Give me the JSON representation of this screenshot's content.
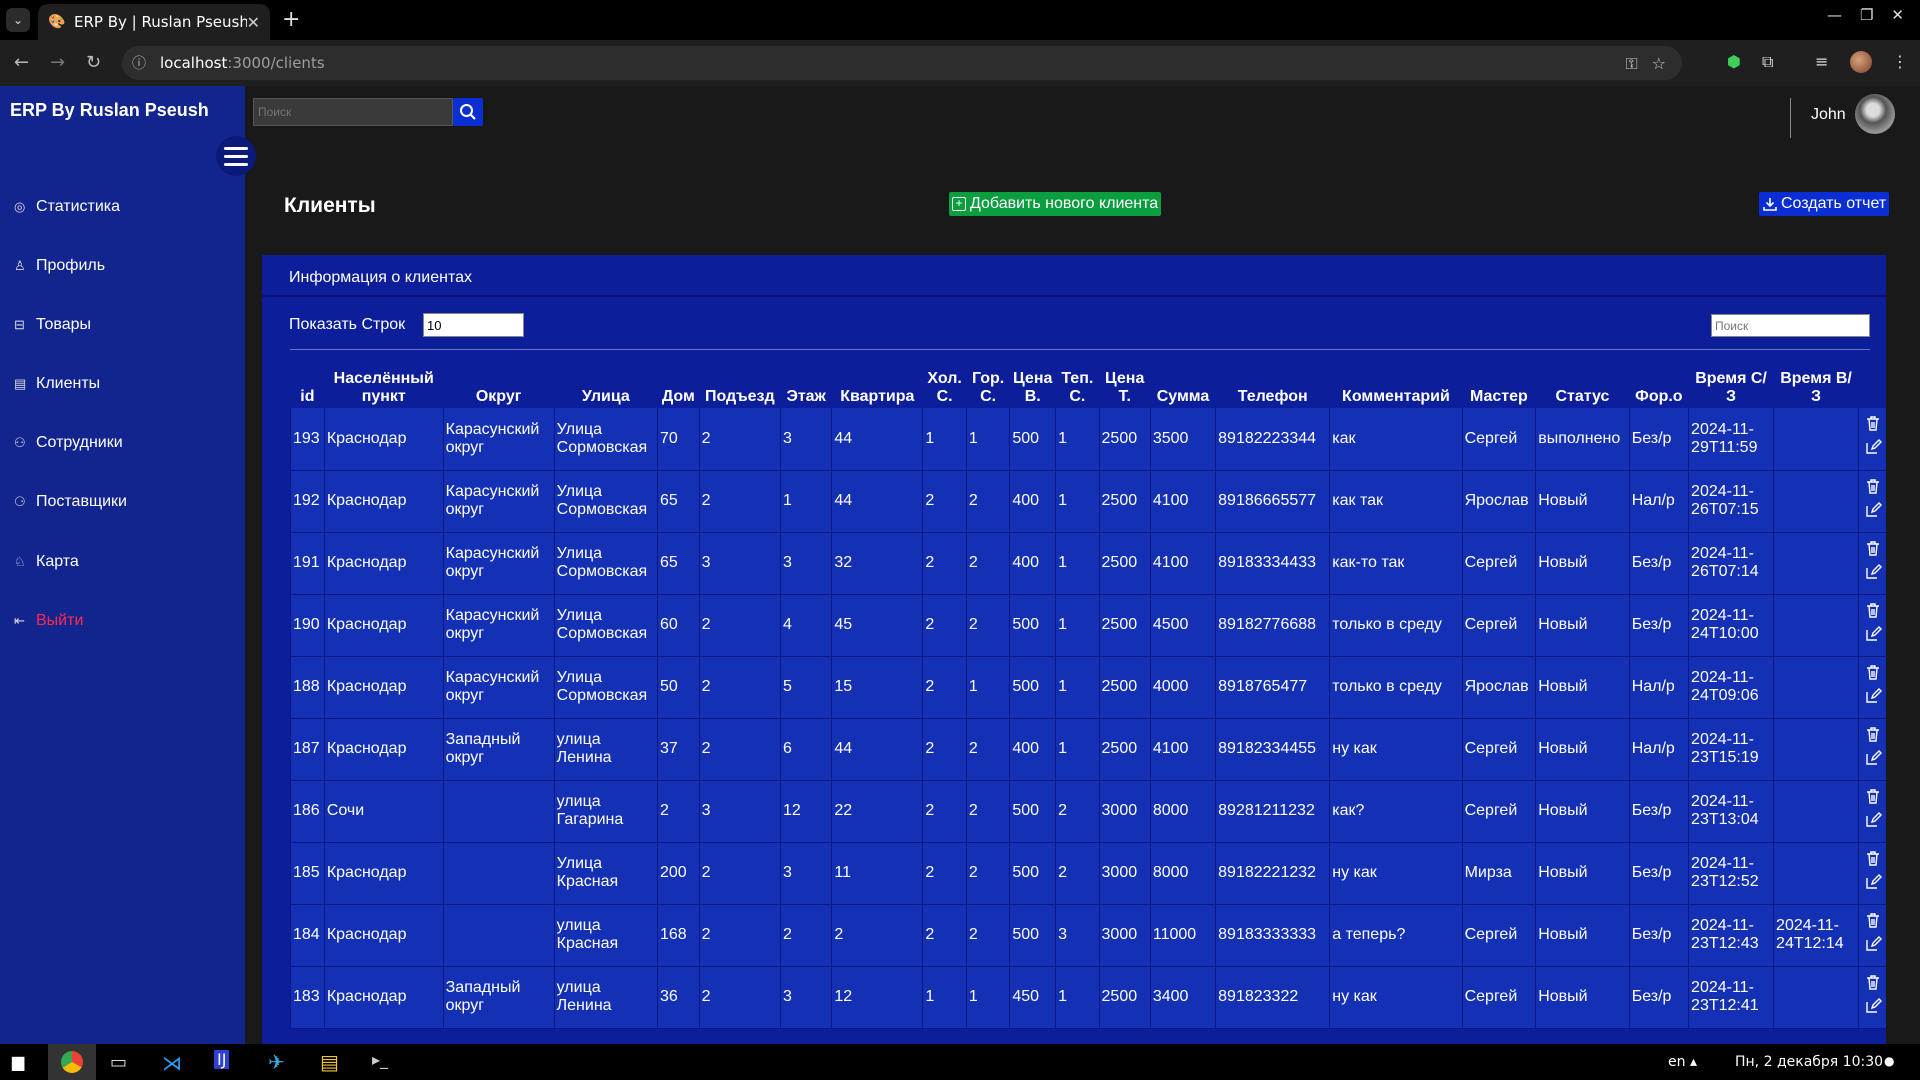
{
  "browser": {
    "tab_title": "ERP By | Ruslan Pseush",
    "url_host": "localhost",
    "url_path": ":3000/clients"
  },
  "app": {
    "brand": "ERP By Ruslan Pseush",
    "search_placeholder": "Поиск",
    "user_name": "John"
  },
  "sidebar": {
    "items": [
      {
        "label": "Статистика",
        "icon": "gauge-icon"
      },
      {
        "label": "Профиль",
        "icon": "user-icon"
      },
      {
        "label": "Товары",
        "icon": "box-icon"
      },
      {
        "label": "Клиенты",
        "icon": "monitor-icon"
      },
      {
        "label": "Сотрудники",
        "icon": "users-icon"
      },
      {
        "label": "Поставщики",
        "icon": "supplier-icon"
      },
      {
        "label": "Карта",
        "icon": "map-icon"
      },
      {
        "label": "Выйти",
        "icon": "logout-icon"
      }
    ]
  },
  "page": {
    "title": "Клиенты",
    "add_button": "Добавить нового клиента",
    "report_button": "Создать отчет",
    "card_title": "Информация о клиентах",
    "rows_label": "Показать Строк",
    "rows_value": "10",
    "table_search_placeholder": "Поиск"
  },
  "table": {
    "headers": [
      "id",
      "Населённый пункт",
      "Округ",
      "Улица",
      "Дом",
      "Подъезд",
      "Этаж",
      "Квартира",
      "Хол. С.",
      "Гор. С.",
      "Цена В.",
      "Теп. С.",
      "Цена Т.",
      "Сумма",
      "Телефон",
      "Комментарий",
      "Мастер",
      "Статус",
      "Фор.о",
      "Время С/З",
      "Время В/З"
    ],
    "rows": [
      [
        "193",
        "Краснодар",
        "Карасунский округ",
        "Улица Сормовская",
        "70",
        "2",
        "3",
        "44",
        "1",
        "1",
        "500",
        "1",
        "2500",
        "3500",
        "89182223344",
        "как",
        "Сергей",
        "выполнено",
        "Без/р",
        "2024-11-29T11:59",
        ""
      ],
      [
        "192",
        "Краснодар",
        "Карасунский округ",
        "Улица Сормовская",
        "65",
        "2",
        "1",
        "44",
        "2",
        "2",
        "400",
        "1",
        "2500",
        "4100",
        "89186665577",
        "как так",
        "Ярослав",
        "Новый",
        "Нал/р",
        "2024-11-26T07:15",
        ""
      ],
      [
        "191",
        "Краснодар",
        "Карасунский округ",
        "Улица Сормовская",
        "65",
        "3",
        "3",
        "32",
        "2",
        "2",
        "400",
        "1",
        "2500",
        "4100",
        "89183334433",
        "как-то так",
        "Сергей",
        "Новый",
        "Без/р",
        "2024-11-26T07:14",
        ""
      ],
      [
        "190",
        "Краснодар",
        "Карасунский округ",
        "Улица Сормовская",
        "60",
        "2",
        "4",
        "45",
        "2",
        "2",
        "500",
        "1",
        "2500",
        "4500",
        "89182776688",
        "только в среду",
        "Сергей",
        "Новый",
        "Без/р",
        "2024-11-24T10:00",
        ""
      ],
      [
        "188",
        "Краснодар",
        "Карасунский округ",
        "Улица Сормовская",
        "50",
        "2",
        "5",
        "15",
        "2",
        "1",
        "500",
        "1",
        "2500",
        "4000",
        "8918765477",
        "только в среду",
        "Ярослав",
        "Новый",
        "Нал/р",
        "2024-11-24T09:06",
        ""
      ],
      [
        "187",
        "Краснодар",
        "Западный округ",
        "улица Ленина",
        "37",
        "2",
        "6",
        "44",
        "2",
        "2",
        "400",
        "1",
        "2500",
        "4100",
        "89182334455",
        "ну как",
        "Сергей",
        "Новый",
        "Нал/р",
        "2024-11-23T15:19",
        ""
      ],
      [
        "186",
        "Сочи",
        "",
        "улица Гагарина",
        "2",
        "3",
        "12",
        "22",
        "2",
        "2",
        "500",
        "2",
        "3000",
        "8000",
        "89281211232",
        "как?",
        "Сергей",
        "Новый",
        "Без/р",
        "2024-11-23T13:04",
        ""
      ],
      [
        "185",
        "Краснодар",
        "",
        "Улица Красная",
        "200",
        "2",
        "3",
        "11",
        "2",
        "2",
        "500",
        "2",
        "3000",
        "8000",
        "89182221232",
        "ну как",
        "Мирза",
        "Новый",
        "Без/р",
        "2024-11-23T12:52",
        ""
      ],
      [
        "184",
        "Краснодар",
        "",
        "улица Красная",
        "168",
        "2",
        "2",
        "2",
        "2",
        "2",
        "500",
        "3",
        "3000",
        "11000",
        "89183333333",
        "а теперь?",
        "Сергей",
        "Новый",
        "Без/р",
        "2024-11-23T12:43",
        "2024-11-24T12:14"
      ],
      [
        "183",
        "Краснодар",
        "Западный округ",
        "улица Ленина",
        "36",
        "2",
        "3",
        "12",
        "1",
        "1",
        "450",
        "1",
        "2500",
        "3400",
        "891823322",
        "ну как",
        "Сергей",
        "Новый",
        "Без/р",
        "2024-11-23T12:41",
        ""
      ]
    ]
  },
  "taskbar": {
    "lang": "en",
    "datetime": "Пн, 2 декабря 10:30"
  }
}
